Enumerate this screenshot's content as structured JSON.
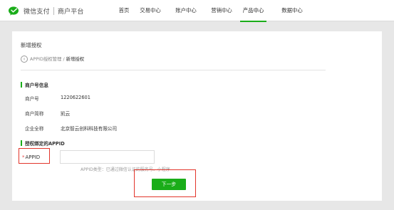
{
  "header": {
    "logo_text": "微信支付",
    "platform_text": "商户平台",
    "nav": [
      {
        "label": "首页"
      },
      {
        "label": "交易中心"
      },
      {
        "label": "账户中心"
      },
      {
        "label": "营销中心"
      },
      {
        "label": "产品中心",
        "active": true
      },
      {
        "label": "数据中心"
      }
    ]
  },
  "page": {
    "title": "新增授权",
    "breadcrumb": {
      "parent": "APPID授权管理",
      "separator": "/",
      "current": "新增授权"
    }
  },
  "merchant_info": {
    "section_title": "商户号信息",
    "rows": [
      {
        "label": "商户号",
        "value": "1220622601"
      },
      {
        "label": "商户简称",
        "value": "凯云"
      },
      {
        "label": "企业全称",
        "value": "北京智云创科科技有限公司"
      }
    ]
  },
  "appid_section": {
    "section_title": "授权绑定的APPID",
    "required_mark": "*",
    "label": "APPID",
    "input_value": "",
    "hint": "APPID类型：已通过微信认证的服务号、小程序"
  },
  "actions": {
    "next_label": "下一步"
  },
  "colors": {
    "accent": "#1aad19",
    "highlight": "#e2352b",
    "background": "#e7e7e7"
  }
}
